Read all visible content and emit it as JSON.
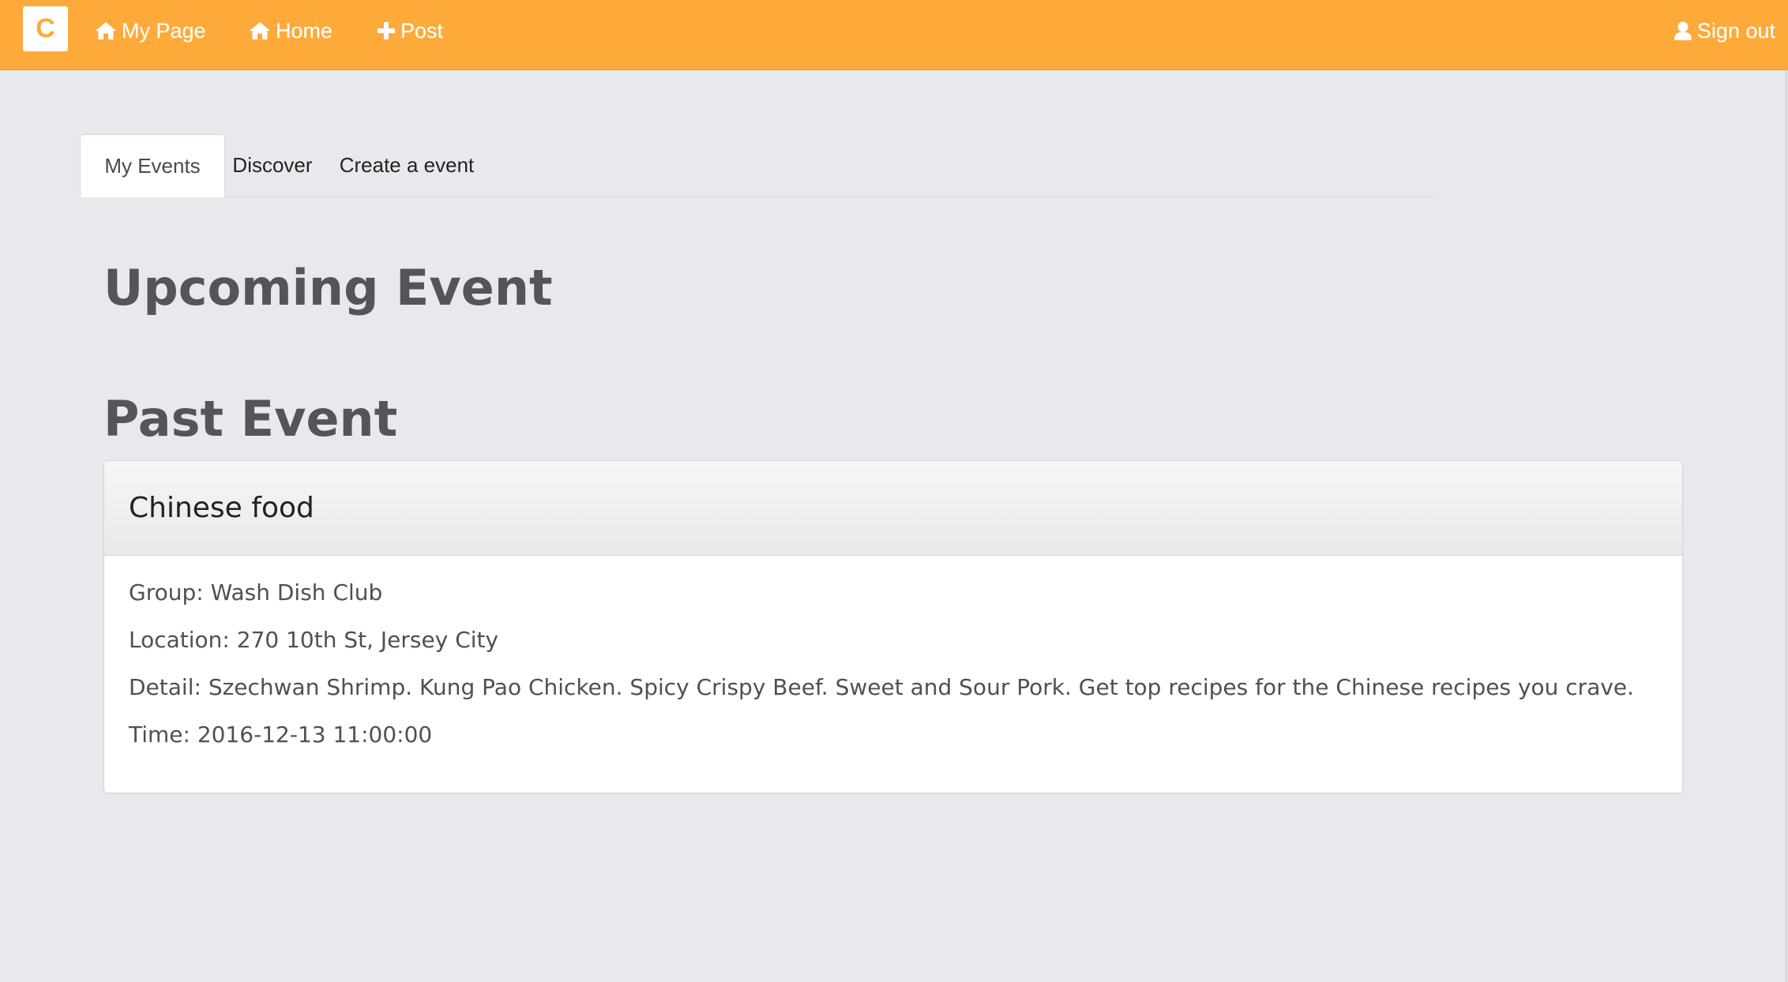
{
  "navbar": {
    "brand_letter": "C",
    "links": [
      {
        "label": "My Page",
        "icon": "home-icon"
      },
      {
        "label": "Home",
        "icon": "home-icon"
      },
      {
        "label": "Post",
        "icon": "plus-icon"
      }
    ],
    "sign_out": {
      "label": "Sign out",
      "icon": "user-icon"
    },
    "color": "#fdaa3a"
  },
  "tabs": [
    {
      "label": "My Events",
      "active": true
    },
    {
      "label": "Discover",
      "active": false
    },
    {
      "label": "Create a event",
      "active": false
    }
  ],
  "sections": {
    "upcoming_title": "Upcoming Event",
    "past_title": "Past Event"
  },
  "past_events": [
    {
      "title": "Chinese food",
      "group": "Group: Wash Dish Club",
      "location": "Location: 270 10th St, Jersey City",
      "detail": "Detail: Szechwan Shrimp. Kung Pao Chicken. Spicy Crispy Beef. Sweet and Sour Pork. Get top recipes for the Chinese recipes you crave.",
      "time": "Time: 2016-12-13 11:00:00"
    }
  ]
}
